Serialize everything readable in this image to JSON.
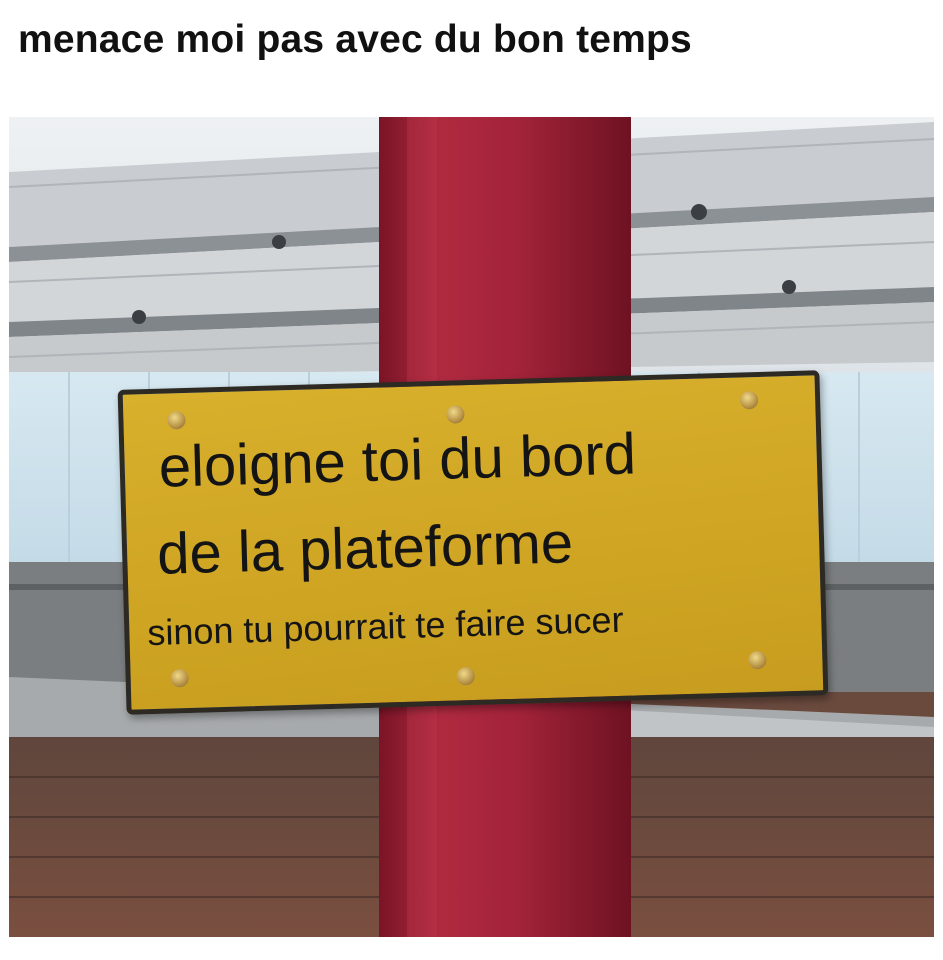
{
  "caption": "menace moi pas avec du bon temps",
  "sign": {
    "line1": "eloigne toi du bord",
    "line2": "de la plateforme",
    "line3": "sinon tu pourrait te faire sucer"
  },
  "colors": {
    "pole": "#9e2235",
    "sign_background": "#d2a826",
    "sign_border": "#2d2a24",
    "wall": "#cfe3ee",
    "brick": "#6b4a3e"
  }
}
